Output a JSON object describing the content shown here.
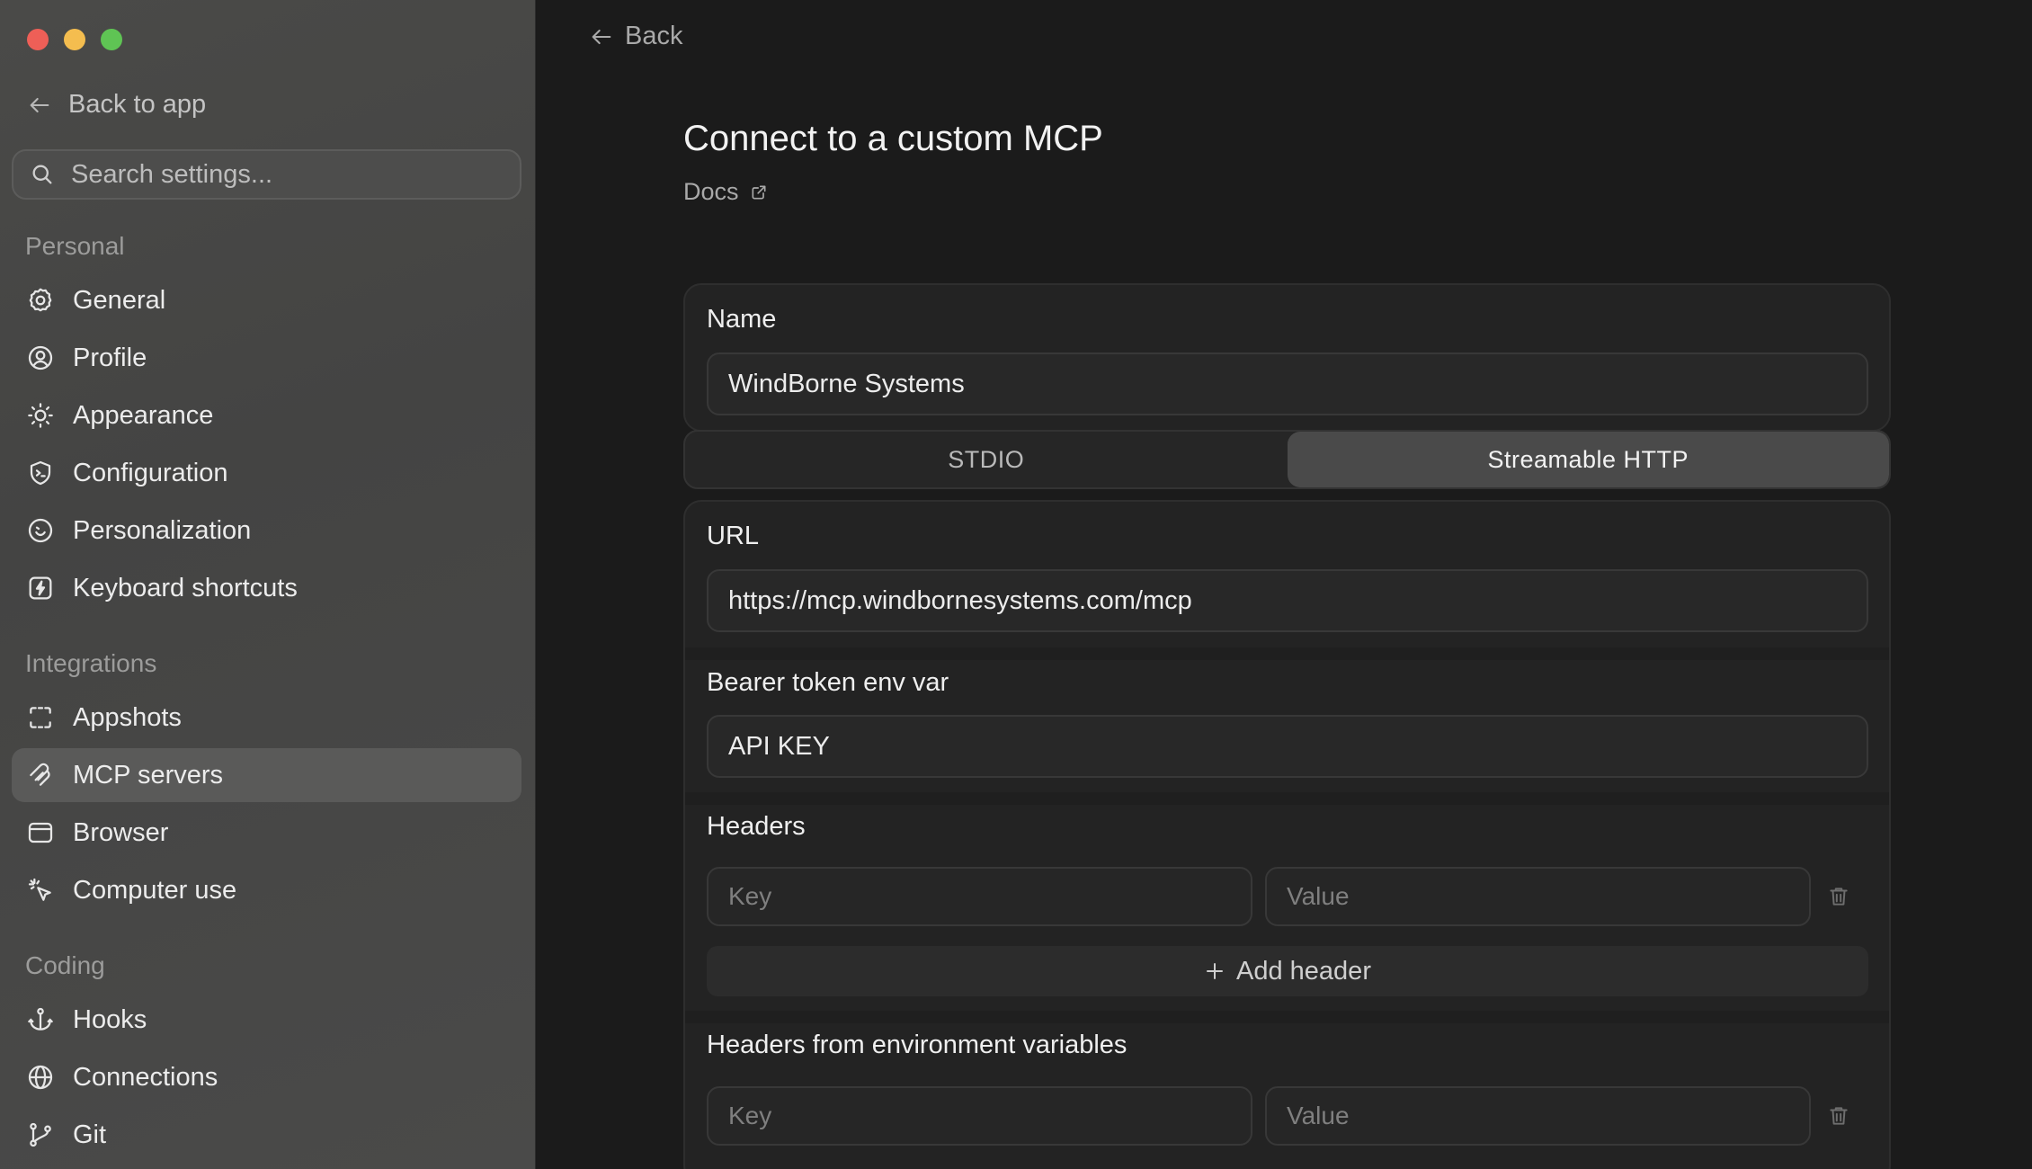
{
  "sidebar": {
    "back_to_app": "Back to app",
    "search_placeholder": "Search settings...",
    "sections": {
      "personal": "Personal",
      "integrations": "Integrations",
      "coding": "Coding"
    },
    "items": {
      "general": "General",
      "profile": "Profile",
      "appearance": "Appearance",
      "configuration": "Configuration",
      "personalization": "Personalization",
      "keyboard_shortcuts": "Keyboard shortcuts",
      "appshots": "Appshots",
      "mcp_servers": "MCP servers",
      "browser": "Browser",
      "computer_use": "Computer use",
      "hooks": "Hooks",
      "connections": "Connections",
      "git": "Git"
    },
    "active_item": "MCP servers"
  },
  "main": {
    "back": "Back",
    "title": "Connect to a custom MCP",
    "docs": "Docs",
    "name_label": "Name",
    "name_value": "WindBorne Systems",
    "transport_tabs": [
      "STDIO",
      "Streamable HTTP"
    ],
    "selected_transport": "Streamable HTTP",
    "url_label": "URL",
    "url_value": "https://mcp.windbornesystems.com/mcp",
    "bearer_label": "Bearer token env var",
    "bearer_value": "API KEY",
    "headers_label": "Headers",
    "key_placeholder": "Key",
    "value_placeholder": "Value",
    "add_header": "Add header",
    "env_headers_label": "Headers from environment variables"
  },
  "colors": {
    "traffic_red": "#ee5f57",
    "traffic_yellow": "#f4bd4f",
    "traffic_green": "#5fc454",
    "sidebar_bg": "#474746",
    "main_bg": "#1b1b1b"
  }
}
